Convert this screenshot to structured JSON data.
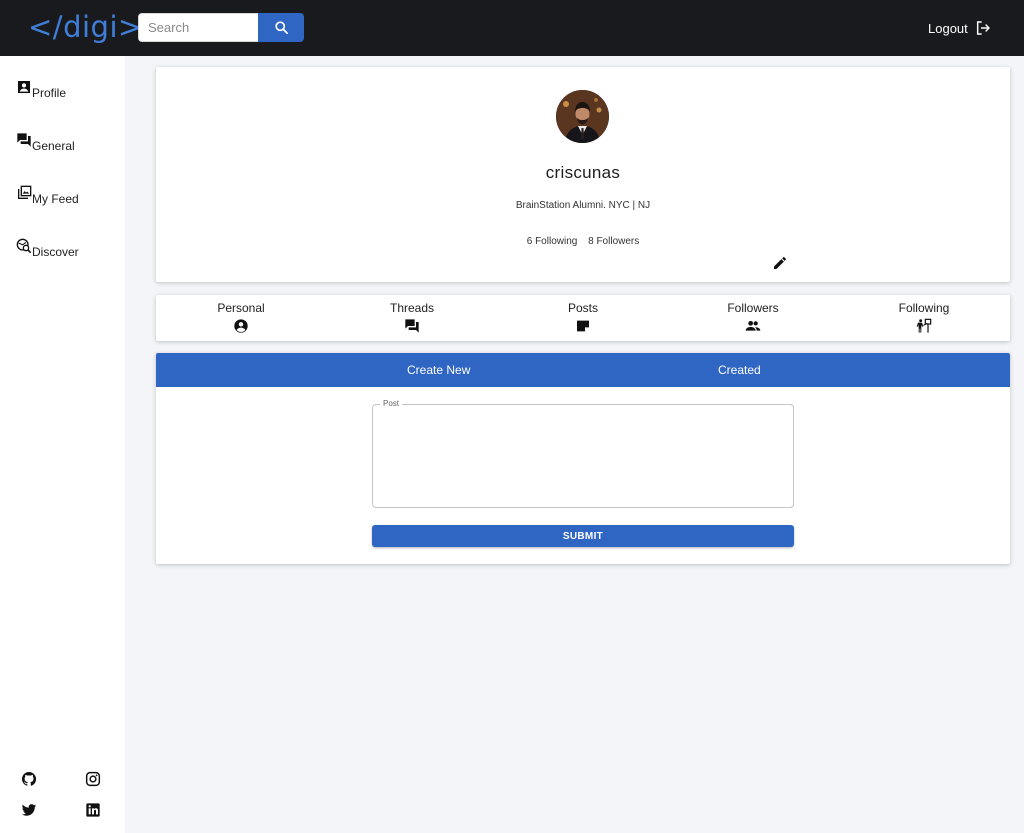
{
  "header": {
    "logo": "</digi>",
    "search": {
      "placeholder": "Search",
      "value": "",
      "button_icon": "search-icon"
    },
    "logout": {
      "label": "Logout",
      "icon": "logout-icon"
    }
  },
  "sidebar": {
    "items": [
      {
        "label": "Profile",
        "icon": "account-box-icon"
      },
      {
        "label": "General",
        "icon": "forum-icon"
      },
      {
        "label": "My Feed",
        "icon": "collections-icon"
      },
      {
        "label": "Discover",
        "icon": "travel-explore-icon"
      }
    ],
    "social": [
      "github-icon",
      "instagram-icon",
      "twitter-icon",
      "linkedin-icon"
    ]
  },
  "profile": {
    "username": "criscunas",
    "bio": "BrainStation Alumni. NYC | NJ",
    "following": "6 Following",
    "followers": "8 Followers",
    "edit_icon": "edit-pencil-icon"
  },
  "tabs": [
    {
      "label": "Personal",
      "icon": "account-circle-icon"
    },
    {
      "label": "Threads",
      "icon": "forum-icon"
    },
    {
      "label": "Posts",
      "icon": "sticky-note-icon"
    },
    {
      "label": "Followers",
      "icon": "people-icon"
    },
    {
      "label": "Following",
      "icon": "follow-sign-icon"
    }
  ],
  "post_panel": {
    "tabs": [
      "Create New",
      "Created"
    ],
    "field_label": "Post",
    "field_value": "",
    "submit_label": "SUBMIT"
  },
  "colors": {
    "topbar": "#191a1e",
    "accent": "#2f66c4",
    "logo": "#3f7fd8",
    "page_background": "#f3f5f8"
  }
}
